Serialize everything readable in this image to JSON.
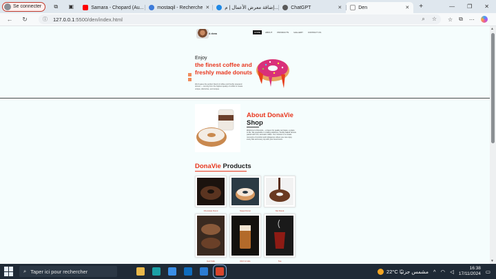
{
  "browser": {
    "profile_label": "Se connecter",
    "tabs": [
      {
        "label": "Samara - Chopard (Au...",
        "favicon_color": "#ff0000",
        "icon": "youtube-icon",
        "active": false
      },
      {
        "label": "mostaqil - Recherche",
        "favicon_color": "#3d7bd9",
        "icon": "search-icon",
        "active": false
      },
      {
        "label": "إضافة معرض الأعمال | م...",
        "favicon_color": "#1e88e5",
        "icon": "site-icon",
        "active": false
      },
      {
        "label": "ChatGPT",
        "favicon_color": "#5a5a5a",
        "icon": "chatgpt-icon",
        "active": false
      },
      {
        "label": "Den",
        "favicon_color": "#cfcfcf",
        "icon": "page-icon",
        "active": true
      }
    ],
    "url_host": "127.0.0.1",
    "url_path": ":5500/den/index.html"
  },
  "site": {
    "logo_text": "& dona",
    "nav": [
      "HOME",
      "ABOUT",
      "PRODUCTS",
      "GALLERY",
      "CONTACT US"
    ],
    "hero": {
      "enjoy": "Enjoy",
      "title": "the finest coffee and freshly made donuts",
      "description": "We'd agree the perfect blend of coffee and freshly prepared donuts — coming from the highest quality of coffee to create unique, distinctive, and unique."
    },
    "about": {
      "title": "About DonaVie",
      "subtitle": "Shop",
      "text": "Welcome to DonaVie – a haven for quality and taste, a place to life. We specialize in crafting delicious, freshly baked donuts paired with rich, aromatic coffee. Our mission is to create moments of comfort and indulgence where you can enjoy every bite and every sip with your loved ones."
    },
    "products": {
      "brand": "DonaVie",
      "title": "Products",
      "items": [
        {
          "name": "Chocolate Donut"
        },
        {
          "name": "Sweet Donut"
        },
        {
          "name": "Nut Donut"
        },
        {
          "name": "Iced Cafe"
        },
        {
          "name": "Rich & Cafe"
        },
        {
          "name": "Tea"
        }
      ]
    }
  },
  "taskbar": {
    "search_placeholder": "Taper ici pour rechercher",
    "weather": "22°C  مشمس جزئيًا",
    "time": "16:38",
    "date": "17/11/2024"
  },
  "colors": {
    "accent": "#e8361d",
    "tab_bar": "#dfe7ee",
    "taskbar": "#1f2a36"
  }
}
